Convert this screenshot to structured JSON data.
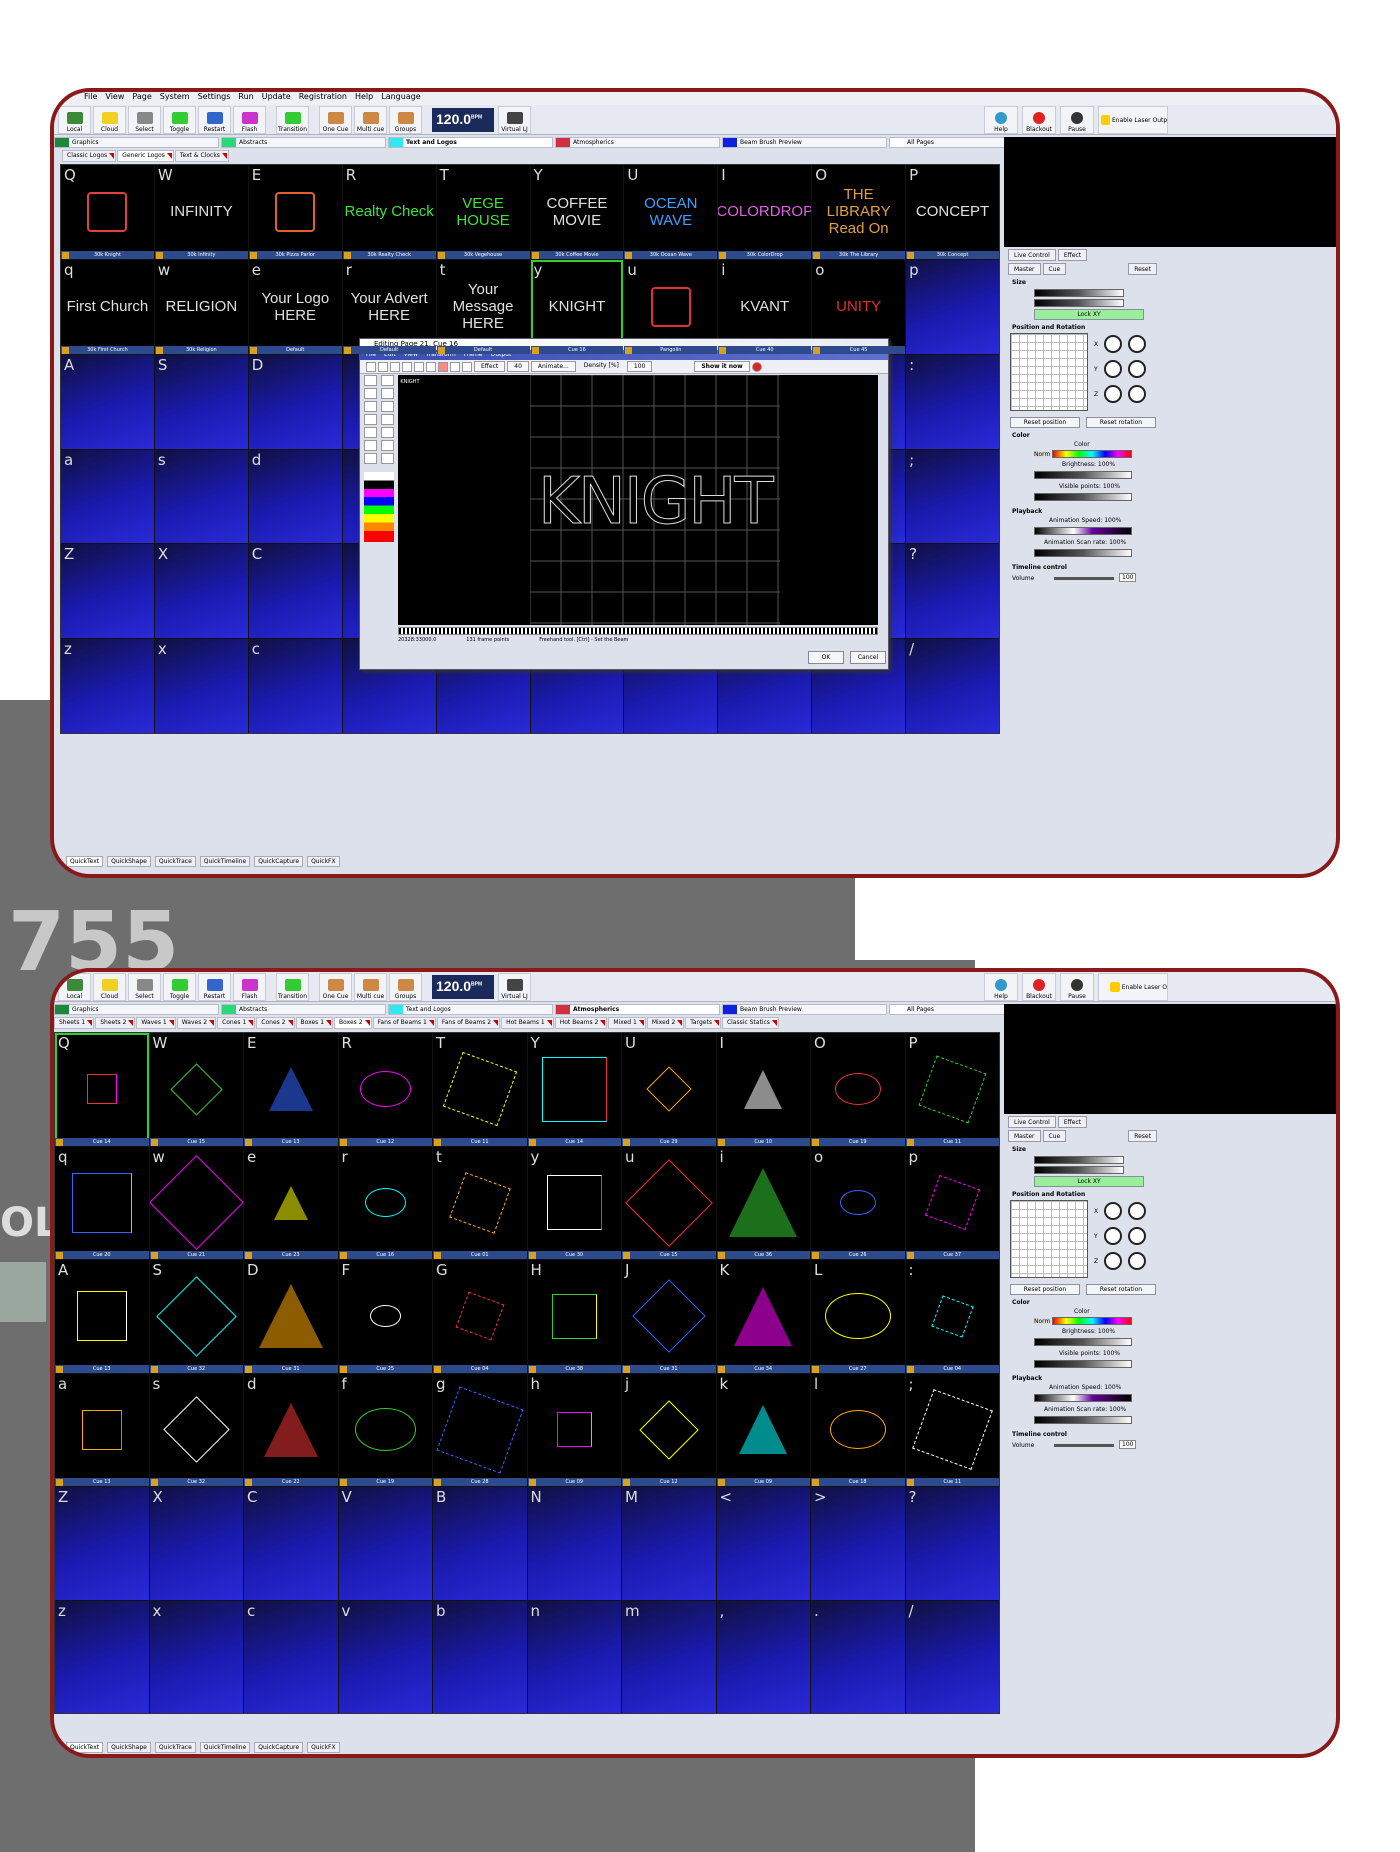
{
  "background": {
    "model_number": "755",
    "side_text": "OL"
  },
  "app": {
    "menu": [
      "File",
      "View",
      "Page",
      "System",
      "Settings",
      "Run",
      "Update",
      "Registration",
      "Help",
      "Language"
    ],
    "toolbar": [
      "Local",
      "Cloud",
      "Select",
      "Toggle",
      "Restart",
      "Flash",
      "Transition",
      "One Cue",
      "Multi cue",
      "Groups"
    ],
    "bpm": "120.0",
    "bpm_unit": "BPM",
    "virtual_lj": "Virtual LJ",
    "right_buttons": [
      "Help",
      "Blackout",
      "Pause"
    ],
    "enable_laser": "Enable Laser Output",
    "enable_laser_short": "Enable Laser O",
    "pages": [
      {
        "name": "Graphics",
        "color": "#1a8a3a"
      },
      {
        "name": "Abstracts",
        "color": "#2ad87a"
      },
      {
        "name": "Text and Logos",
        "color": "#30e8f0"
      },
      {
        "name": "Atmospherics",
        "color": "#d03040"
      },
      {
        "name": "Beam Brush Preview",
        "color": "#1020e0"
      },
      {
        "name": "All Pages",
        "color": "#ffffff"
      }
    ]
  },
  "screenA": {
    "subtabs": [
      "Classic Logos",
      "Generic Logos",
      "Text & Clocks"
    ],
    "cells": [
      {
        "key": "Q",
        "label": "30k Knight",
        "art": "",
        "color": "#e04040"
      },
      {
        "key": "W",
        "label": "30k Infinity",
        "art": "INFINITY",
        "color": "#e0e0e0"
      },
      {
        "key": "E",
        "label": "30k Pizza Parlor",
        "art": "",
        "color": "#e06030"
      },
      {
        "key": "R",
        "label": "30k Realty Check",
        "art": "Realty Check",
        "color": "#40e040"
      },
      {
        "key": "T",
        "label": "30k Vegehouse",
        "art": "VEGE HOUSE",
        "color": "#40e040"
      },
      {
        "key": "Y",
        "label": "30k Coffee Movie",
        "art": "COFFEE MOVIE",
        "color": "#e0e0e0"
      },
      {
        "key": "U",
        "label": "30k Ocean Wave",
        "art": "OCEAN WAVE",
        "color": "#40a0ff"
      },
      {
        "key": "I",
        "label": "30k ColorDrop",
        "art": "COLORDROP",
        "color": "#e060e0"
      },
      {
        "key": "O",
        "label": "30k The Library",
        "art": "THE LIBRARY Read On",
        "color": "#e0a040"
      },
      {
        "key": "P",
        "label": "30k Concept",
        "art": "CONCEPT",
        "color": "#e0e0e0"
      },
      {
        "key": "q",
        "label": "30k First Church",
        "art": "First Church",
        "color": "#e0e0e0"
      },
      {
        "key": "w",
        "label": "30k Religion",
        "art": "RELIGION",
        "color": "#e0e0e0"
      },
      {
        "key": "e",
        "label": "Default",
        "art": "Your Logo HERE",
        "color": "#e0e0e0"
      },
      {
        "key": "r",
        "label": "Default",
        "art": "Your Advert HERE",
        "color": "#e0e0e0"
      },
      {
        "key": "t",
        "label": "Default",
        "art": "Your Message HERE",
        "color": "#e0e0e0"
      },
      {
        "key": "y",
        "label": "Cue 16",
        "art": "KNIGHT",
        "color": "#e0e0e0",
        "selected": true
      },
      {
        "key": "u",
        "label": "Pangolin",
        "art": "",
        "color": "#e03030"
      },
      {
        "key": "i",
        "label": "Cue 40",
        "art": "KVANT",
        "color": "#e0e0e0"
      },
      {
        "key": "o",
        "label": "Cue 45",
        "art": "UNITY",
        "color": "#e03030"
      },
      {
        "key": "p",
        "label": "",
        "art": "",
        "empty": true
      },
      {
        "key": "A",
        "empty": true
      },
      {
        "key": "S",
        "empty": true
      },
      {
        "key": "D",
        "empty": true
      },
      {
        "key": "",
        "empty": true
      },
      {
        "key": "",
        "empty": true
      },
      {
        "key": "",
        "empty": true
      },
      {
        "key": "",
        "empty": true
      },
      {
        "key": "",
        "empty": true
      },
      {
        "key": "",
        "empty": true
      },
      {
        "key": ":",
        "empty": true
      },
      {
        "key": "a",
        "empty": true
      },
      {
        "key": "s",
        "empty": true
      },
      {
        "key": "d",
        "empty": true
      },
      {
        "key": "",
        "empty": true
      },
      {
        "key": "",
        "empty": true
      },
      {
        "key": "",
        "empty": true
      },
      {
        "key": "",
        "empty": true
      },
      {
        "key": "",
        "empty": true
      },
      {
        "key": "",
        "empty": true
      },
      {
        "key": ";",
        "empty": true
      },
      {
        "key": "Z",
        "empty": true
      },
      {
        "key": "X",
        "empty": true
      },
      {
        "key": "C",
        "empty": true
      },
      {
        "key": "",
        "empty": true
      },
      {
        "key": "",
        "empty": true
      },
      {
        "key": "",
        "empty": true
      },
      {
        "key": "",
        "empty": true
      },
      {
        "key": "",
        "empty": true
      },
      {
        "key": "",
        "empty": true
      },
      {
        "key": "?",
        "empty": true
      },
      {
        "key": "z",
        "empty": true
      },
      {
        "key": "x",
        "empty": true
      },
      {
        "key": "c",
        "empty": true
      },
      {
        "key": "",
        "empty": true
      },
      {
        "key": "",
        "empty": true
      },
      {
        "key": "",
        "empty": true
      },
      {
        "key": "",
        "empty": true
      },
      {
        "key": "",
        "empty": true
      },
      {
        "key": "",
        "empty": true
      },
      {
        "key": "/",
        "empty": true
      }
    ],
    "editor": {
      "title": "Editing Page 21, Cue 16",
      "menu": [
        "File",
        "Edit",
        "View",
        "Transform",
        "Frame",
        "Output"
      ],
      "effect": "Effect",
      "effect_value": "40",
      "animate": "Animate...",
      "density": "Density [%]",
      "density_value": "100",
      "show_it_now": "Show it now",
      "thumb_text": "KNIGHT",
      "canvas_text": "KNIGHT",
      "status_coords": "20328:33000.0",
      "status_points": "131 frame points",
      "status_tool": "Freehand tool. [Ctrl] - Set the Beam",
      "ok": "OK",
      "cancel": "Cancel"
    },
    "bottom_tabs": [
      "QuickText",
      "QuickShape",
      "QuickTrace",
      "QuickTimeline",
      "QuickCapture",
      "QuickFX"
    ]
  },
  "screenB": {
    "subtabs": [
      "Sheets 1",
      "Sheets 2",
      "Waves 1",
      "Waves 2",
      "Cones 1",
      "Cones 2",
      "Boxes 1",
      "Boxes 2",
      "Fans of Beams 1",
      "Fans of Beams 2",
      "Hot Beams 1",
      "Hot Beams 2",
      "Mixed 1",
      "Mixed 2",
      "Targets",
      "Classic Statics"
    ],
    "active_subtab": "Boxes 2",
    "keys": [
      "Q",
      "W",
      "E",
      "R",
      "T",
      "Y",
      "U",
      "I",
      "O",
      "P",
      "q",
      "w",
      "e",
      "r",
      "t",
      "y",
      "u",
      "i",
      "o",
      "p",
      "A",
      "S",
      "D",
      "F",
      "G",
      "H",
      "J",
      "K",
      "L",
      ":",
      "a",
      "s",
      "d",
      "f",
      "g",
      "h",
      "j",
      "k",
      "l",
      ";",
      "Z",
      "X",
      "C",
      "V",
      "B",
      "N",
      "M",
      "<",
      ">",
      "?",
      "z",
      "x",
      "c",
      "v",
      "b",
      "n",
      "m",
      ",",
      ".",
      "/"
    ],
    "labels": [
      "Cue 14",
      "Cue 15",
      "Cue 13",
      "Cue 12",
      "Cue 11",
      "Cue 14",
      "Cue 29",
      "Cue 10",
      "Cue 19",
      "Cue 11",
      "Cue 20",
      "Cue 21",
      "Cue 23",
      "Cue 16",
      "Cue 01",
      "Cue 30",
      "Cue 15",
      "Cue 36",
      "Cue 26",
      "Cue 37",
      "Cue 13",
      "Cue 32",
      "Cue 31",
      "Cue 25",
      "Cue 04",
      "Cue 38",
      "Cue 31",
      "Cue 34",
      "Cue 27",
      "Cue 04",
      "Cue 13",
      "Cue 32",
      "Cue 22",
      "Cue 19",
      "Cue 28",
      "Cue 09",
      "Cue 12",
      "Cue 09",
      "Cue 18",
      "Cue 11"
    ],
    "bottom_tabs": [
      "QuickText",
      "QuickShape",
      "QuickTrace",
      "QuickTimeline",
      "QuickCapture",
      "QuickFX"
    ]
  },
  "live_panel": {
    "tabs": [
      "Live Control",
      "Effect"
    ],
    "sub": [
      "Master",
      "Cue",
      "Reset"
    ],
    "size": "Size",
    "lock": "Lock XY",
    "position": "Position and Rotation",
    "axes": [
      "X",
      "Y",
      "Z"
    ],
    "reset_position": "Reset position",
    "reset_rotation": "Reset rotation",
    "color": "Color",
    "color_label": "Color",
    "norm": "Norm",
    "brightness": "Brightness: 100%",
    "visible_points": "Visible points: 100%",
    "playback": "Playback",
    "animation_speed": "Animation Speed: 100%",
    "scan_rate": "Animation Scan rate: 100%",
    "timeline": "Timeline control",
    "volume": "Volume",
    "volume_value": "100"
  }
}
